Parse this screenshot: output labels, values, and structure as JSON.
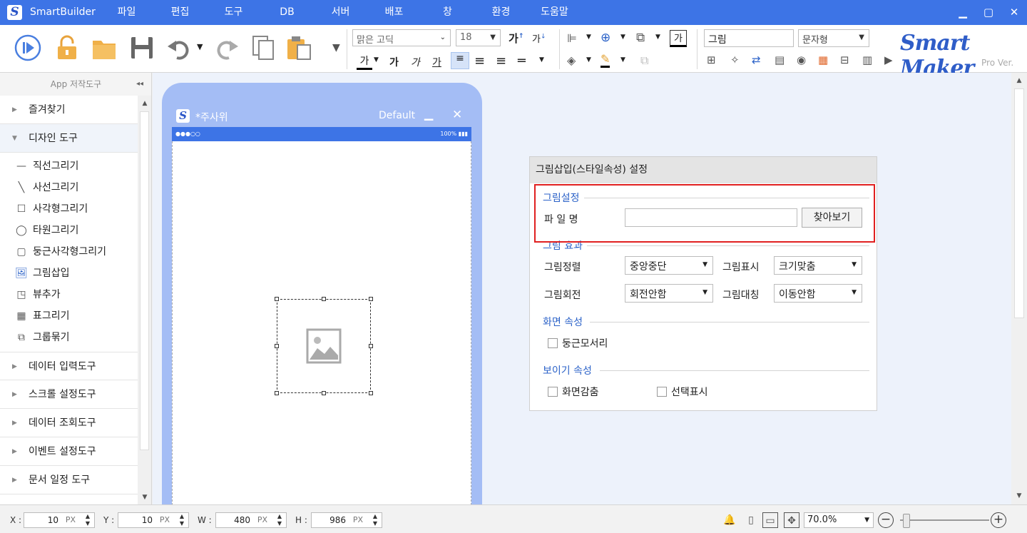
{
  "titlebar": {
    "app_name": "SmartBuilder",
    "menu": [
      "파일",
      "편집",
      "도구",
      "DB",
      "서버",
      "배포",
      "창",
      "환경",
      "도움말"
    ]
  },
  "toolbar": {
    "font_family": "맑은 고딕",
    "font_size": "18",
    "picture_select": "그림",
    "string_select": "문자형",
    "brand": "Smart Maker",
    "brand_sub": "Pro Ver."
  },
  "left_panel": {
    "header": "App 저작도구",
    "categories_top": [
      "즐겨찾기",
      "디자인 도구"
    ],
    "design_tools": [
      "직선그리기",
      "사선그리기",
      "사각형그리기",
      "타원그리기",
      "둥근사각형그리기",
      "그림삽입",
      "뷰추가",
      "표그리기",
      "그룹묶기"
    ],
    "categories_bottom": [
      "데이터 입력도구",
      "스크롤 설정도구",
      "데이터 조회도구",
      "이벤트 설정도구",
      "문서 일정 도구"
    ]
  },
  "phone": {
    "title": "*주사위",
    "mode": "Default",
    "status_left": "●●●○○",
    "status_right": "100%"
  },
  "settings": {
    "header": "그림삽입(스타일속성) 설정",
    "sec_picture": "그림설정",
    "filename_label": "파 일 명",
    "filename_value": "",
    "browse_button": "찾아보기",
    "sec_effect": "그림 효과",
    "align_label": "그림정렬",
    "align_value": "중앙중단",
    "display_label": "그림표시",
    "display_value": "크기맞춤",
    "rotate_label": "그림회전",
    "rotate_value": "회전안함",
    "mirror_label": "그림대칭",
    "mirror_value": "이동안함",
    "sec_screen": "화면 속성",
    "rounded_corner": "둥근모서리",
    "sec_visibility": "보이기 속성",
    "hide_screen": "화면감춤",
    "show_selection": "선택표시"
  },
  "statusbar": {
    "x_label": "X :",
    "x_value": "10",
    "y_label": "Y :",
    "y_value": "10",
    "w_label": "W :",
    "w_value": "480",
    "h_label": "H :",
    "h_value": "986",
    "unit": "PX",
    "zoom": "70.0%"
  },
  "colors": {
    "accent": "#3d74e6",
    "highlight_box": "#e02020",
    "section_title": "#2b62c8"
  }
}
